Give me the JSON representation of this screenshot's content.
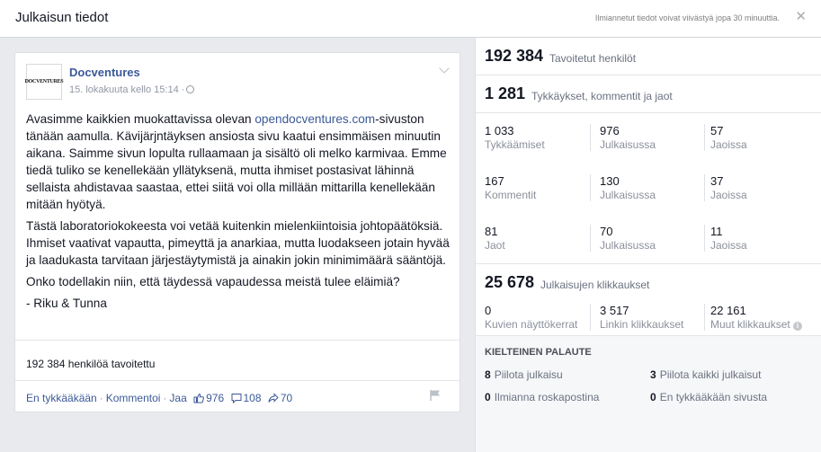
{
  "header": {
    "title": "Julkaisun tiedot",
    "notice": "Ilmiannetut tiedot voivat viivästyä jopa 30 minuuttia.",
    "close_glyph": "✕"
  },
  "post": {
    "logo_text": "DOCVENTURES",
    "page_name": "Docventures",
    "time": "15. lokakuuta kello 15:14 ·",
    "p1_before": "Avasimme kaikkien muokattavissa olevan ",
    "p1_link": "opendocventures.com",
    "p1_after": "-sivuston tänään aamulla. Kävijärjntäyksen ansiosta sivu kaatui ensimmäisen minuutin aikana. Saimme sivun lopulta rullaamaan ja sisältö oli melko karmivaa. Emme tiedä tuliko se kenellekään yllätyksenä, mutta ihmiset postasivat lähinnä sellaista ahdistavaa saastaa, ettei siitä voi olla millään mittarilla kenellekään mitään hyötyä.",
    "p2": "Tästä laboratoriokokeesta voi vetää kuitenkin mielenkiintoisia johtopäätöksiä. Ihmiset vaativat vapautta, pimeyttä ja anarkiaa, mutta luodakseen jotain hyvää ja laadukasta tarvitaan järjestäytymistä ja ainakin jokin minimimäärä sääntöjä.",
    "p3": "Onko todellakin niin, että täydessä vapaudessa meistä tulee eläimiä?",
    "p4": "- Riku & Tunna",
    "reach": "192 384 henkilöä tavoitettu",
    "actions": {
      "unlike": "En tykkääkään",
      "comment": "Kommentoi",
      "share": "Jaa",
      "likes": "976",
      "comments": "108",
      "shares": "70"
    }
  },
  "stats": {
    "reach_value": "192 384",
    "reach_label": "Tavoitetut henkilöt",
    "engagement_value": "1 281",
    "engagement_label": "Tykkäykset, kommentit ja jaot",
    "likes": [
      {
        "value": "1 033",
        "label": "Tykkäämiset"
      },
      {
        "value": "976",
        "label": "Julkaisussa"
      },
      {
        "value": "57",
        "label": "Jaoissa"
      }
    ],
    "comments": [
      {
        "value": "167",
        "label": "Kommentit"
      },
      {
        "value": "130",
        "label": "Julkaisussa"
      },
      {
        "value": "37",
        "label": "Jaoissa"
      }
    ],
    "shares": [
      {
        "value": "81",
        "label": "Jaot"
      },
      {
        "value": "70",
        "label": "Julkaisussa"
      },
      {
        "value": "11",
        "label": "Jaoissa"
      }
    ],
    "clicks_value": "25 678",
    "clicks_label": "Julkaisujen klikkaukset",
    "clicks": [
      {
        "value": "0",
        "label": "Kuvien näyttökerrat"
      },
      {
        "value": "3 517",
        "label": "Linkin klikkaukset"
      },
      {
        "value": "22 161",
        "label": "Muut klikkaukset"
      }
    ],
    "negative_title": "KIELTEINEN PALAUTE",
    "negative": [
      {
        "value": "8",
        "label": "Piilota julkaisu"
      },
      {
        "value": "3",
        "label": "Piilota kaikki julkaisut"
      },
      {
        "value": "0",
        "label": "Ilmianna roskapostina"
      },
      {
        "value": "0",
        "label": "En tykkääkään sivusta"
      }
    ]
  }
}
